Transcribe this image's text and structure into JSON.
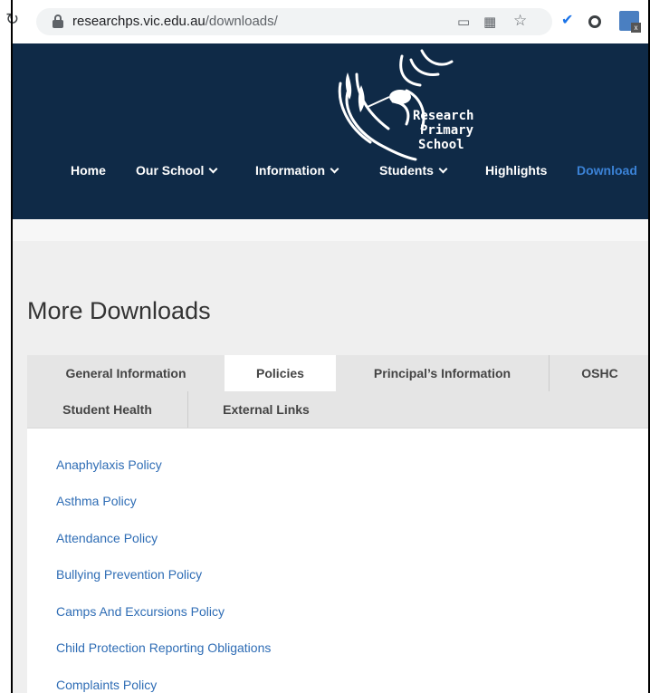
{
  "browser": {
    "url_host": "researchps.vic.edu.au",
    "url_path": "/downloads/"
  },
  "site": {
    "logo_lines": [
      "Research",
      "Primary",
      "School"
    ],
    "nav": [
      {
        "label": "Home",
        "has_dropdown": false
      },
      {
        "label": "Our School",
        "has_dropdown": true
      },
      {
        "label": "Information",
        "has_dropdown": true
      },
      {
        "label": "Students",
        "has_dropdown": true
      },
      {
        "label": "Highlights",
        "has_dropdown": false
      },
      {
        "label": "Download",
        "has_dropdown": false,
        "active": true
      }
    ],
    "colors": {
      "header_bg": "#0f2a47",
      "link": "#2f6db5",
      "nav_active": "#3b82d6"
    }
  },
  "page": {
    "title": "More Downloads",
    "tabs": [
      {
        "label": "General Information"
      },
      {
        "label": "Policies",
        "active": true
      },
      {
        "label": "Principal’s Information"
      },
      {
        "label": "OSHC"
      },
      {
        "label": "Student Health"
      },
      {
        "label": "External Links"
      }
    ],
    "links": [
      "Anaphylaxis Policy",
      "Asthma Policy",
      "Attendance Policy",
      "Bullying Prevention Policy",
      "Camps And Excursions Policy",
      "Child Protection Reporting Obligations",
      "Complaints Policy"
    ]
  }
}
